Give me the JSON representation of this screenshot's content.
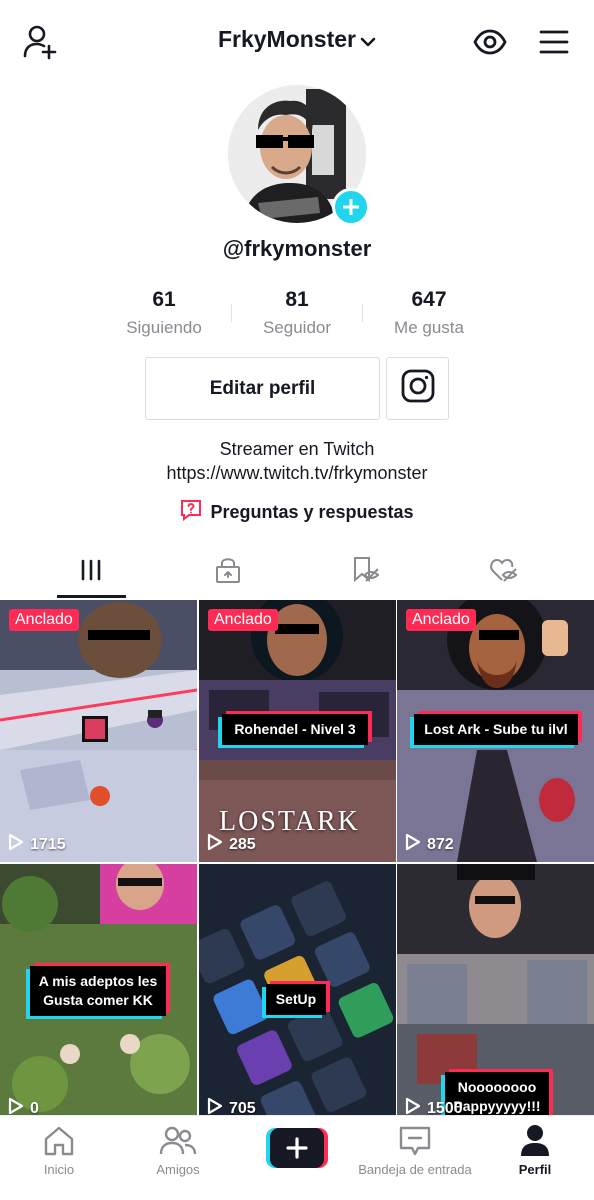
{
  "header": {
    "username": "FrkyMonster"
  },
  "profile": {
    "handle": "@frkymonster",
    "stats": [
      {
        "value": "61",
        "label": "Siguiendo"
      },
      {
        "value": "81",
        "label": "Seguidor"
      },
      {
        "value": "647",
        "label": "Me gusta"
      }
    ],
    "edit_button": "Editar perfil",
    "bio_line1": "Streamer en Twitch",
    "bio_line2": "https://www.twitch.tv/frkymonster",
    "qa_label": "Preguntas y respuestas"
  },
  "tabs": [
    {
      "icon": "grid-icon",
      "active": true
    },
    {
      "icon": "lock-icon",
      "active": false
    },
    {
      "icon": "bookmark-hidden-icon",
      "active": false
    },
    {
      "icon": "liked-hidden-icon",
      "active": false
    }
  ],
  "videos": [
    {
      "pinned_label": "Anclado",
      "caption": "",
      "views": "1715"
    },
    {
      "pinned_label": "Anclado",
      "caption": "Rohendel - Nivel 3",
      "overlay_text": "LOSTARK",
      "views": "285"
    },
    {
      "pinned_label": "Anclado",
      "caption": "Lost Ark - Sube tu ilvl",
      "views": "872"
    },
    {
      "pinned_label": "",
      "caption": "A mis adeptos les Gusta comer KK",
      "views": "0"
    },
    {
      "pinned_label": "",
      "caption": "SetUp",
      "views": "705"
    },
    {
      "pinned_label": "",
      "caption": "Noooooooo Pappyyyyy!!!",
      "views": "1500"
    }
  ],
  "bottom_nav": [
    {
      "label": "Inicio",
      "icon": "home-icon",
      "active": false
    },
    {
      "label": "Amigos",
      "icon": "friends-icon",
      "active": false
    },
    {
      "label": "",
      "icon": "create-plus-icon",
      "active": false
    },
    {
      "label": "Bandeja de entrada",
      "icon": "inbox-icon",
      "active": false
    },
    {
      "label": "Perfil",
      "icon": "profile-icon",
      "active": true
    }
  ],
  "colors": {
    "accent_red": "#fe2c55",
    "accent_cyan": "#20d5ec",
    "text_primary": "#161823",
    "text_secondary": "#8a8b91"
  }
}
